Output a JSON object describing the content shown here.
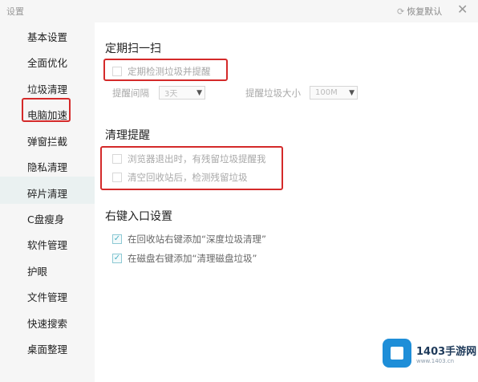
{
  "window": {
    "title": "设置",
    "restore_label": "恢复默认",
    "restore_icon": "refresh-icon",
    "close_icon": "close-icon"
  },
  "sidebar": {
    "items": [
      {
        "label": "基本设置"
      },
      {
        "label": "全面优化"
      },
      {
        "label": "垃圾清理"
      },
      {
        "label": "电脑加速"
      },
      {
        "label": "弹窗拦截"
      },
      {
        "label": "隐私清理"
      },
      {
        "label": "碎片清理"
      },
      {
        "label": "C盘瘦身"
      },
      {
        "label": "软件管理"
      },
      {
        "label": "护眼"
      },
      {
        "label": "文件管理"
      },
      {
        "label": "快速搜索"
      },
      {
        "label": "桌面整理"
      }
    ],
    "active": "隐私清理",
    "highlighted": "垃圾清理"
  },
  "scan": {
    "title": "定期扫一扫",
    "periodic_label": "定期检测垃圾并提醒",
    "periodic_checked": false,
    "interval_label": "提醒间隔",
    "interval_value": "3天",
    "size_label": "提醒垃圾大小",
    "size_value": "100M"
  },
  "reminder": {
    "title": "清理提醒",
    "browser_exit_label": "浏览器退出时，有残留垃圾提醒我",
    "browser_exit_checked": false,
    "recycle_bin_label": "清空回收站后，检测残留垃圾",
    "recycle_bin_checked": false
  },
  "context_menu": {
    "title": "右键入口设置",
    "recycle_label": "在回收站右键添加“深度垃圾清理”",
    "recycle_checked": true,
    "disk_label": "在磁盘右键添加“清理磁盘垃圾”",
    "disk_checked": true
  },
  "watermark": {
    "name": "1403手游网",
    "url": "www.1403.cn"
  },
  "colors": {
    "highlight_border": "#d42a2a",
    "checkbox_accent": "#4bb0c4",
    "brand": "#1e8ed8"
  }
}
